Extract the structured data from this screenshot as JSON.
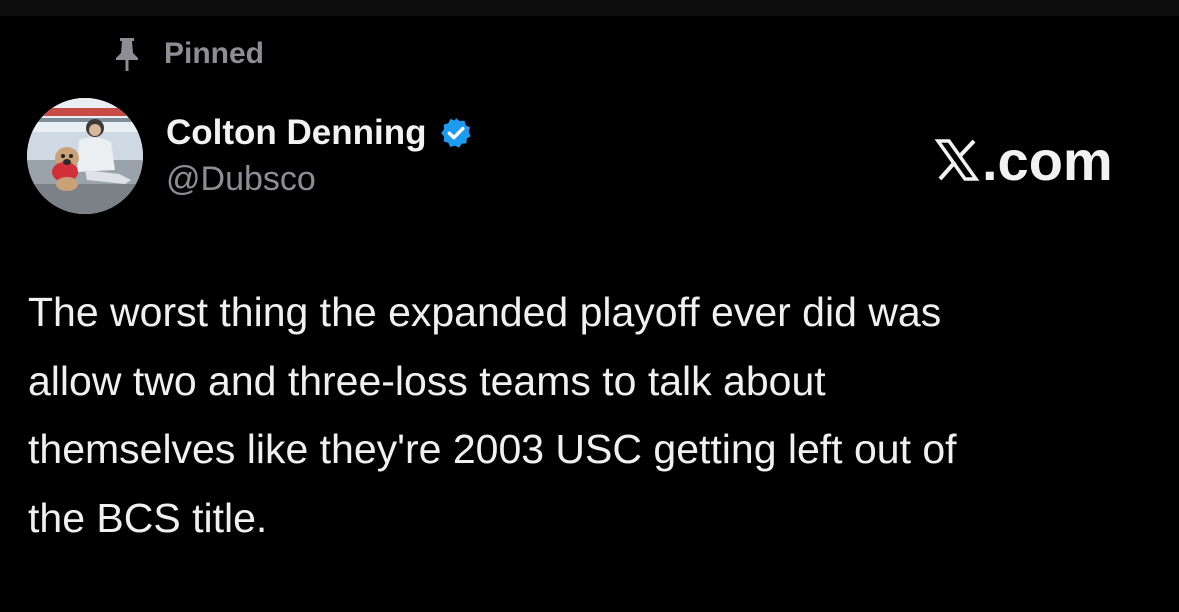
{
  "pinned": {
    "label": "Pinned",
    "icon": "pin-icon"
  },
  "author": {
    "display_name": "Colton Denning",
    "handle": "@Dubsco",
    "verified_icon": "verified-badge-icon",
    "verified_color": "#1d9bf0"
  },
  "site": {
    "logo_icon": "x-logo-icon",
    "domain_suffix": ".com"
  },
  "tweet": {
    "lines": [
      "The worst thing the expanded playoff ever did was",
      "allow two and three-loss teams to talk about",
      "themselves like they're 2003 USC getting left out of",
      "the BCS title."
    ]
  },
  "colors": {
    "background": "#000000",
    "text": "#f0f0f0",
    "muted": "#8b8f94"
  }
}
